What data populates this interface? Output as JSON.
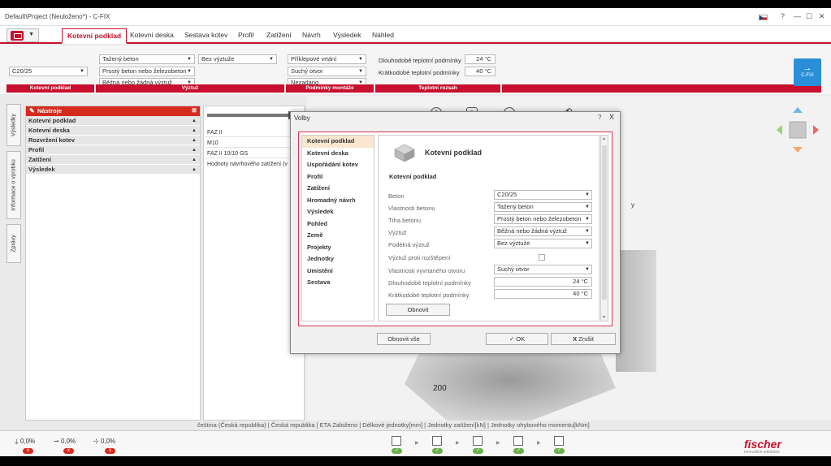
{
  "window": {
    "title": "Default\\Project (Neuloženo*) - C-FIX",
    "controls": {
      "help": "?",
      "min": "—",
      "max": "☐",
      "close": "✕"
    }
  },
  "ribbon": {
    "tabs": [
      {
        "label": "Kotevní podklad"
      },
      {
        "label": "Kotevní deska"
      },
      {
        "label": "Sestava kotev"
      },
      {
        "label": "Profil"
      },
      {
        "label": "Zatížení"
      },
      {
        "label": "Návrh"
      },
      {
        "label": "Výsledek"
      },
      {
        "label": "Náhled"
      }
    ],
    "concrete_class": "C20/25",
    "concrete_state": "Tažený beton",
    "concrete_type": "Prostý beton nebo železobeton",
    "reinforcement": "Běžná nebo žádná výztuž",
    "longitudinal_reinf": "Bez výztuže",
    "drilling": "Příklepové vrtání",
    "hole": "Suchý otvor",
    "setting": "Nezadáno",
    "temp_long_label": "Dlouhodobé teplotní podmínky",
    "temp_long_value": "24 °C",
    "temp_short_label": "Krátkodobé teplotní podmínky",
    "temp_short_value": "40 °C",
    "groups": {
      "base": "Kotevní podklad",
      "reinf": "Výztuž",
      "mount": "Podmínky montáže",
      "temp": "Teplotní rozsah"
    },
    "fix_button": "C-FIX"
  },
  "sidetabs": {
    "results": "Výsledky",
    "product_info": "Informace o výrobku",
    "messages": "Zprávy"
  },
  "tools": {
    "header": "Nástroje",
    "items": [
      {
        "label": "Kotevní podklad"
      },
      {
        "label": "Kotevní deska"
      },
      {
        "label": "Rozvržení kotev"
      },
      {
        "label": "Profil"
      },
      {
        "label": "Zatížení"
      },
      {
        "label": "Výsledek"
      }
    ]
  },
  "product": {
    "rows": [
      "FAZ II",
      "M10",
      "FAZ II 10/10 GS",
      "Hodnoty návrhového zatížení (v"
    ]
  },
  "viewport": {
    "dim_label": "200",
    "axis_y": "y"
  },
  "statusbar": {
    "text": "čeština (Česká republika) |  Česká republika |  ETA Založeno |  Délkové jednotky[mm] |  Jednotky zatížení[kN] |  Jednotky ohybového momentu[kNm]"
  },
  "bottom": {
    "items": [
      {
        "value": "0,0%",
        "badge": "x"
      },
      {
        "value": "0,0%",
        "badge": "x"
      },
      {
        "value": "0,0%",
        "badge": "x"
      }
    ],
    "step_badge": "✓",
    "logo": "fischer",
    "logo_sub": "innovative solutions"
  },
  "dialog": {
    "title": "Volby",
    "help": "?",
    "close": "X",
    "nav": [
      {
        "label": "Kotevní podklad"
      },
      {
        "label": "Kotevní deska"
      },
      {
        "label": "Uspořádání kotev"
      },
      {
        "label": "Profil"
      },
      {
        "label": "Zatížení"
      },
      {
        "label": "Hromadný návrh"
      },
      {
        "label": "Výsledek"
      },
      {
        "label": "Pohled"
      },
      {
        "label": "Země"
      },
      {
        "label": "Projekty"
      },
      {
        "label": "Jednotky"
      },
      {
        "label": "Umístění"
      },
      {
        "label": "Sestava"
      }
    ],
    "content_title": "Kotevní podklad",
    "section_title": "Kotevní podklad",
    "fields": [
      {
        "label": "Beton",
        "value": "C20/25"
      },
      {
        "label": "Vlastnosti betonu",
        "value": "Tažený beton"
      },
      {
        "label": "Tíha betonu",
        "value": "Prostý beton nebo železobeton"
      },
      {
        "label": "Výztuž",
        "value": "Běžná nebo žádná výztuž"
      },
      {
        "label": "Podélná výztuž",
        "value": "Bez výztuže"
      },
      {
        "label": "Výztuž proti rozštěpení",
        "value": ""
      },
      {
        "label": "Vlastnosti vyvrtaného otvoru",
        "value": "Suchý otvor"
      },
      {
        "label": "Dlouhodobé teplotní podmínky",
        "value": "24 °C"
      },
      {
        "label": "Krátkodobé teplotní podmínky",
        "value": "40 °C"
      }
    ],
    "refresh_button": "Obnovit",
    "refresh_all_button": "Obnovit vše",
    "ok_button": "OK",
    "cancel_button": "Zrušit"
  }
}
